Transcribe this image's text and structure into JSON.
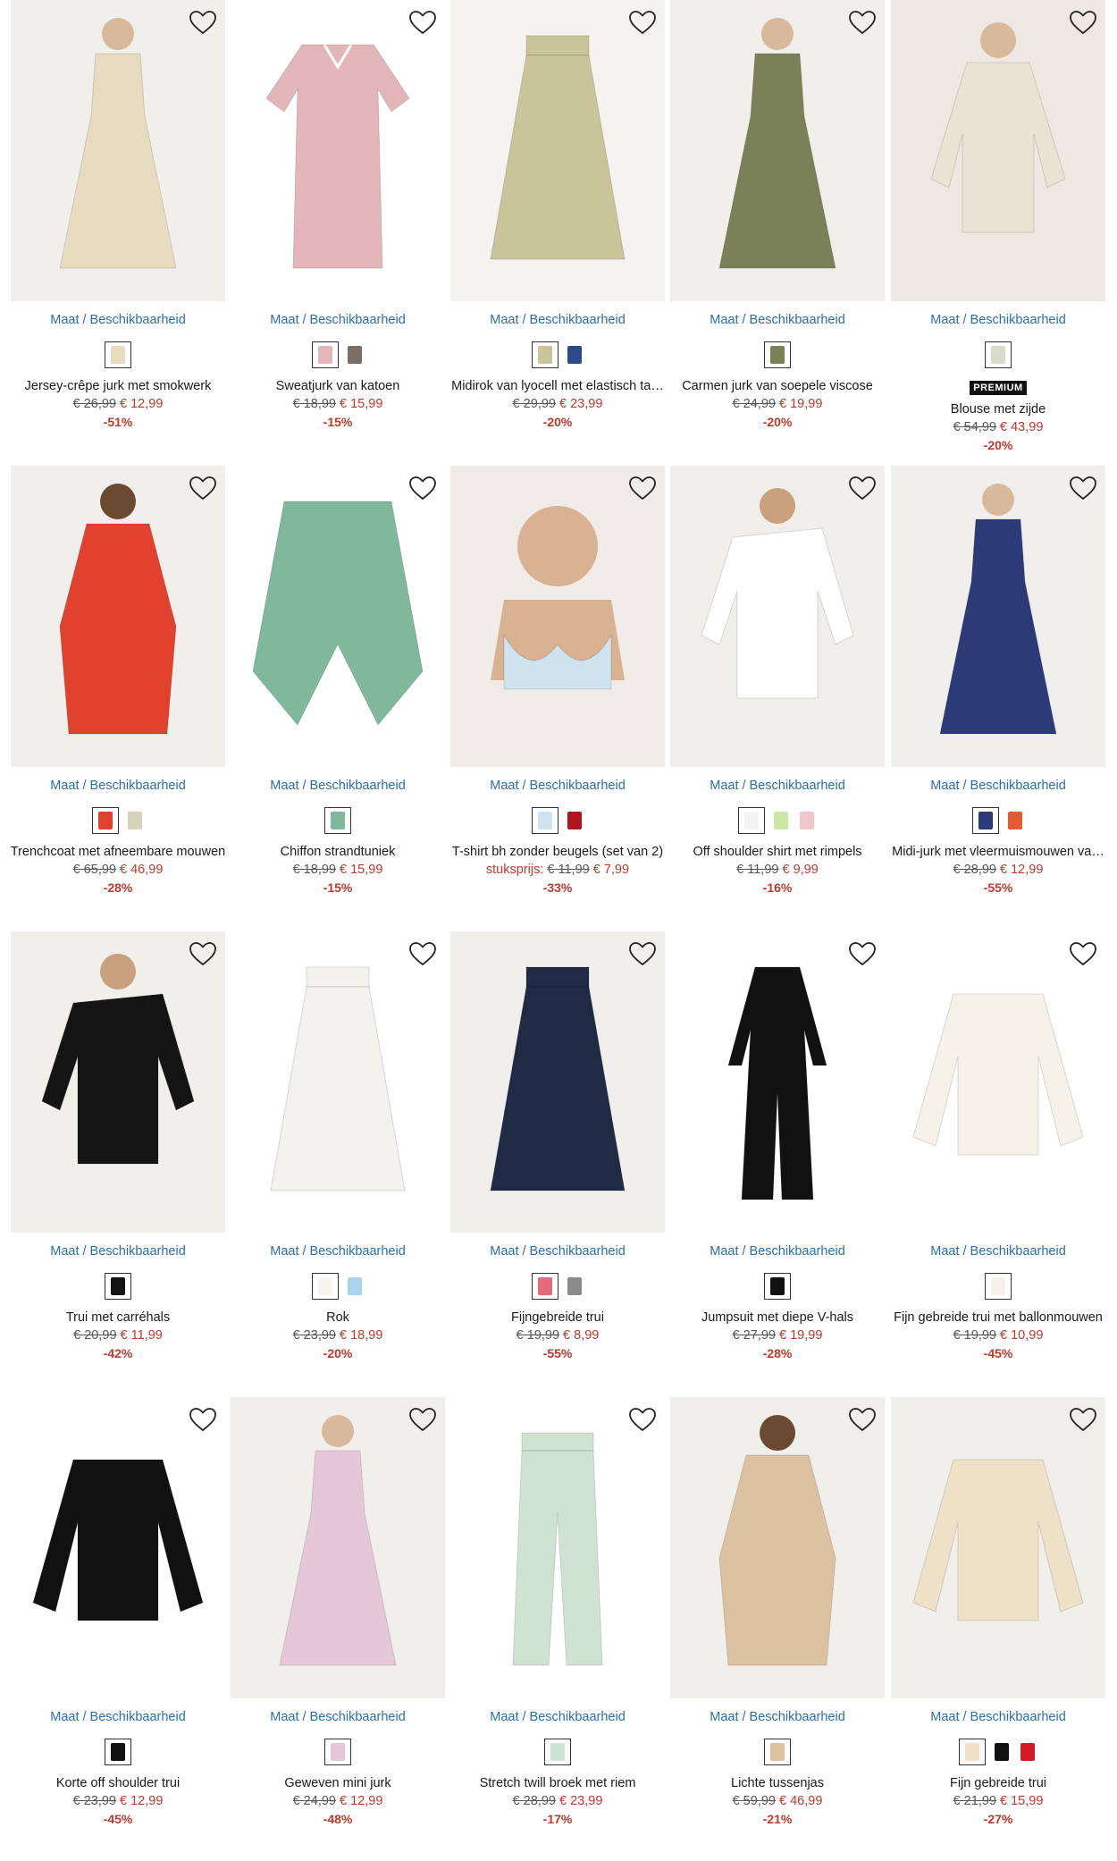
{
  "link_label": "Maat / Beschikbaarheid",
  "colors": {
    "link": "#2a6fad",
    "sale": "#c0392b"
  },
  "products": [
    {
      "name": "Jersey-crêpe jurk met smokwerk",
      "old_price": "€ 26,99",
      "new_price": "€ 12,99",
      "discount": "-51%",
      "swatches": [
        "#e8dcc0"
      ],
      "icon": "heart-icon"
    },
    {
      "name": "Sweatjurk van katoen",
      "old_price": "€ 18,99",
      "new_price": "€ 15,99",
      "discount": "-15%",
      "swatches": [
        "#e3b7b9",
        "#7a6f63"
      ],
      "icon": "heart-icon"
    },
    {
      "name": "Midirok van lyocell met elastisch ta…",
      "old_price": "€ 29,99",
      "new_price": "€ 23,99",
      "discount": "-20%",
      "swatches": [
        "#c9c49a",
        "#2a4a8a"
      ],
      "icon": "heart-icon"
    },
    {
      "name": "Carmen jurk van soepele viscose",
      "old_price": "€ 24,99",
      "new_price": "€ 19,99",
      "discount": "-20%",
      "swatches": [
        "#7b8156"
      ],
      "icon": "heart-icon"
    },
    {
      "name": "Blouse met zijde",
      "old_price": "€ 54,99",
      "new_price": "€ 43,99",
      "discount": "-20%",
      "swatches": [
        "#d8dccb"
      ],
      "badge": "PREMIUM",
      "icon": "heart-icon"
    },
    {
      "name": "Trenchcoat met afneembare mouwen",
      "old_price": "€ 65,99",
      "new_price": "€ 46,99",
      "discount": "-28%",
      "swatches": [
        "#e2412e",
        "#d8d2bb"
      ],
      "icon": "heart-icon"
    },
    {
      "name": "Chiffon strandtuniek",
      "old_price": "€ 18,99",
      "new_price": "€ 15,99",
      "discount": "-15%",
      "swatches": [
        "#7fb89b"
      ],
      "icon": "heart-icon"
    },
    {
      "name": "T-shirt bh zonder beugels (set van 2)",
      "price_prefix": "stuksprijs:",
      "old_price": "€ 11,99",
      "new_price": "€ 7,99",
      "discount": "-33%",
      "swatches": [
        "#cfe3ef",
        "#b0141f"
      ],
      "icon": "heart-icon"
    },
    {
      "name": "Off shoulder shirt met rimpels",
      "old_price": "€ 11,99",
      "new_price": "€ 9,99",
      "discount": "-16%",
      "swatches": [
        "#f3f3f3",
        "#c9e8a4",
        "#f2c7c9"
      ],
      "icon": "heart-icon"
    },
    {
      "name": "Midi-jurk met vleermuismouwen va…",
      "old_price": "€ 28,99",
      "new_price": "€ 12,99",
      "discount": "-55%",
      "swatches": [
        "#2c3a78",
        "#e35b34"
      ],
      "icon": "heart-icon"
    },
    {
      "name": "Trui met carréhals",
      "old_price": "€ 20,99",
      "new_price": "€ 11,99",
      "discount": "-42%",
      "swatches": [
        "#141414"
      ],
      "icon": "heart-icon"
    },
    {
      "name": "Rok",
      "old_price": "€ 23,99",
      "new_price": "€ 18,99",
      "discount": "-20%",
      "swatches": [
        "#f6f4ef",
        "#a9d3ee"
      ],
      "icon": "heart-icon"
    },
    {
      "name": "Fijngebreide trui",
      "old_price": "€ 19,99",
      "new_price": "€ 8,99",
      "discount": "-55%",
      "swatches": [
        "#e46b7b",
        "#8b8b8b"
      ],
      "icon": "heart-icon"
    },
    {
      "name": "Jumpsuit met diepe V-hals",
      "old_price": "€ 27,99",
      "new_price": "€ 19,99",
      "discount": "-28%",
      "swatches": [
        "#111111"
      ],
      "icon": "heart-icon"
    },
    {
      "name": "Fijn gebreide trui met ballonmouwen",
      "old_price": "€ 19,99",
      "new_price": "€ 10,99",
      "discount": "-45%",
      "swatches": [
        "#f5f2ea"
      ],
      "icon": "heart-icon"
    },
    {
      "name": "Korte off shoulder trui",
      "old_price": "€ 23,99",
      "new_price": "€ 12,99",
      "discount": "-45%",
      "swatches": [
        "#111111"
      ],
      "icon": "heart-icon"
    },
    {
      "name": "Geweven mini jurk",
      "old_price": "€ 24,99",
      "new_price": "€ 12,99",
      "discount": "-48%",
      "swatches": [
        "#e6c7d8"
      ],
      "icon": "heart-icon"
    },
    {
      "name": "Stretch twill broek met riem",
      "old_price": "€ 28,99",
      "new_price": "€ 23,99",
      "discount": "-17%",
      "swatches": [
        "#cfe3d2"
      ],
      "icon": "heart-icon"
    },
    {
      "name": "Lichte tussenjas",
      "old_price": "€ 59,99",
      "new_price": "€ 46,99",
      "discount": "-21%",
      "swatches": [
        "#dcc2a0"
      ],
      "icon": "heart-icon"
    },
    {
      "name": "Fijn gebreide trui",
      "old_price": "€ 21,99",
      "new_price": "€ 15,99",
      "discount": "-27%",
      "swatches": [
        "#efe0c8",
        "#111111",
        "#d01c22"
      ],
      "icon": "heart-icon"
    }
  ]
}
